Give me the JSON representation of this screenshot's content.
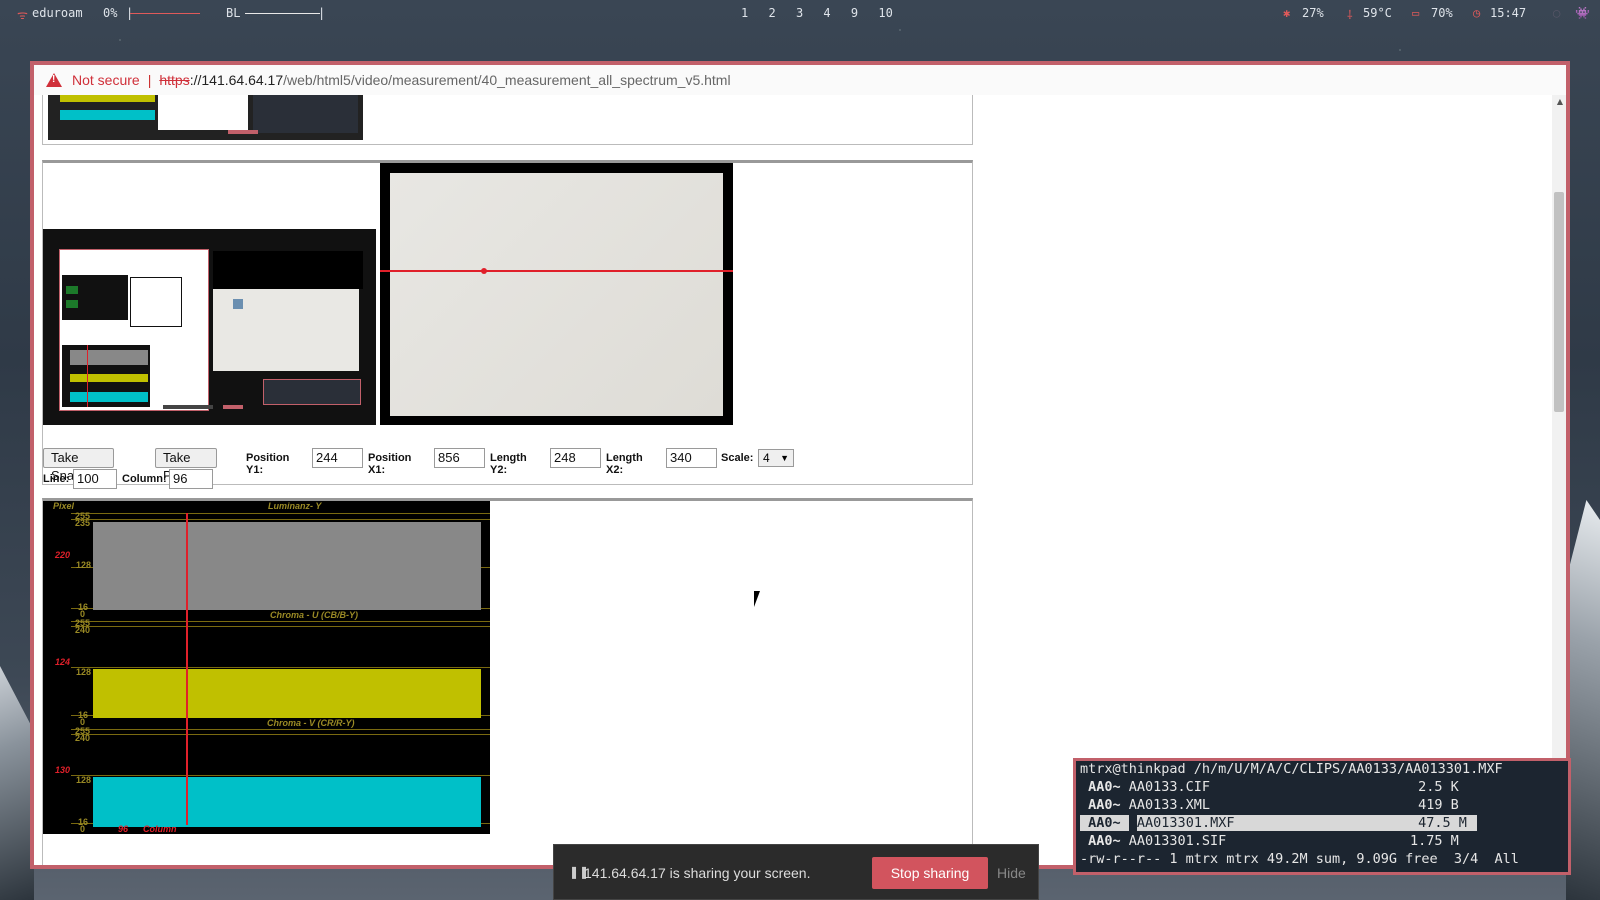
{
  "topbar": {
    "network": "eduroam",
    "volume": "0%",
    "backlight": "BL",
    "workspaces": [
      "1",
      "2",
      "3",
      "4",
      "9",
      "10"
    ],
    "cpu": "27%",
    "temp": "59°C",
    "battery": "70%",
    "clock": "15:47"
  },
  "browser": {
    "not_secure": "Not secure",
    "url_scheme": "https",
    "url_host": "://141.64.64.17",
    "url_path": "/web/html5/video/measurement/40_measurement_all_spectrum_v5.html"
  },
  "controls": {
    "take_snapshot": "Take Snapshot",
    "take_position": "Take Position",
    "position_y1_label": "Position Y1:",
    "position_y1": "244",
    "position_x1_label": "Position X1:",
    "position_x1": "856",
    "length_y2_label": "Length Y2:",
    "length_y2": "248",
    "length_x2_label": "Length X2:",
    "length_x2": "340",
    "scale_label": "Scale:",
    "scale": "4",
    "line_label": "Line:",
    "line": "100",
    "column_label": "Column:",
    "column": "96"
  },
  "graph": {
    "pixel_label": "Pixel",
    "luma_title": "Luminanz- Y",
    "u_title": "Chroma - U (CB/B-Y)",
    "v_title": "Chroma - V (CR/R-Y)",
    "luma_value": "220",
    "u_value": "124",
    "v_value": "130",
    "column_value": "96",
    "column_label": "Column",
    "t255": "255",
    "t235": "235",
    "t240": "240",
    "t128": "128",
    "t16": "16",
    "t0": "0",
    "colors": {
      "luma": "#888888",
      "u": "#c0c000",
      "v": "#00c0c8",
      "cursor": "#e0202a"
    }
  },
  "share": {
    "message": "141.64.64.17 is sharing your screen.",
    "stop": "Stop sharing",
    "hide": "Hide"
  },
  "terminal": {
    "path": "mtrx@thinkpad /h/m/U/M/A/C/CLIPS/AA0133/AA013301.MXF",
    "rows": [
      {
        "prefix": " AA0~ ",
        "name": "AA0133.CIF",
        "size": "2.5 K"
      },
      {
        "prefix": " AA0~ ",
        "name": "AA0133.XML",
        "size": "419 B"
      },
      {
        "prefix": " AA0~ ",
        "name": "AA013301.MXF",
        "size": "47.5 M"
      },
      {
        "prefix": " AA0~ ",
        "name": "AA013301.SIF",
        "size": "1.75 M"
      }
    ],
    "status": "-rw-r--r-- 1 mtrx mtrx 49.2M sum, 9.09G free  3/4  All"
  }
}
